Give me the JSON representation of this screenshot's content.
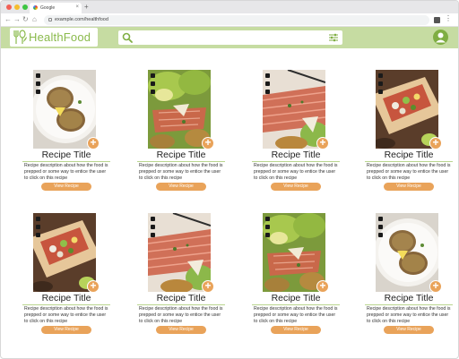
{
  "browser": {
    "tab_title": "Google",
    "tab_close": "×",
    "new_tab": "+",
    "url": "example.com/healthfood",
    "back": "←",
    "forward": "→",
    "reload": "↻",
    "home": "⌂",
    "menu": "⋮"
  },
  "site": {
    "logo_text": "HealthFood",
    "search_value": ""
  },
  "colors": {
    "header_bg": "#c6dca2",
    "accent_green": "#8aba4c",
    "button_orange": "#e9a35a"
  },
  "cards": [
    {
      "title": "Recipe Title",
      "description": "Recipe description about how the food is prepped or some way to entice the user to click on this recipe",
      "button": "View Recipe",
      "add": "+",
      "image": "fritter-plate"
    },
    {
      "title": "Recipe Title",
      "description": "Recipe description about how the food is prepped or some way to entice the user to click on this recipe",
      "button": "View Recipe",
      "add": "+",
      "image": "salmon-salad"
    },
    {
      "title": "Recipe Title",
      "description": "Recipe description about how the food is prepped or some way to entice the user to click on this recipe",
      "button": "View Recipe",
      "add": "+",
      "image": "salmon-closeup"
    },
    {
      "title": "Recipe Title",
      "description": "Recipe description about how the food is prepped or some way to entice the user to click on this recipe",
      "button": "View Recipe",
      "add": "+",
      "image": "wrap"
    },
    {
      "title": "Recipe Title",
      "description": "Recipe description about how the food is prepped or some way to entice the user to click on this recipe",
      "button": "View Recipe",
      "add": "+",
      "image": "wrap"
    },
    {
      "title": "Recipe Title",
      "description": "Recipe description about how the food is prepped or some way to entice the user to click on this recipe",
      "button": "View Recipe",
      "add": "+",
      "image": "salmon-closeup"
    },
    {
      "title": "Recipe Title",
      "description": "Recipe description about how the food is prepped or some way to entice the user to click on this recipe",
      "button": "View Recipe",
      "add": "+",
      "image": "salmon-salad"
    },
    {
      "title": "Recipe Title",
      "description": "Recipe description about how the food is prepped or some way to entice the user to click on this recipe",
      "button": "View Recipe",
      "add": "+",
      "image": "fritter-plate"
    }
  ]
}
